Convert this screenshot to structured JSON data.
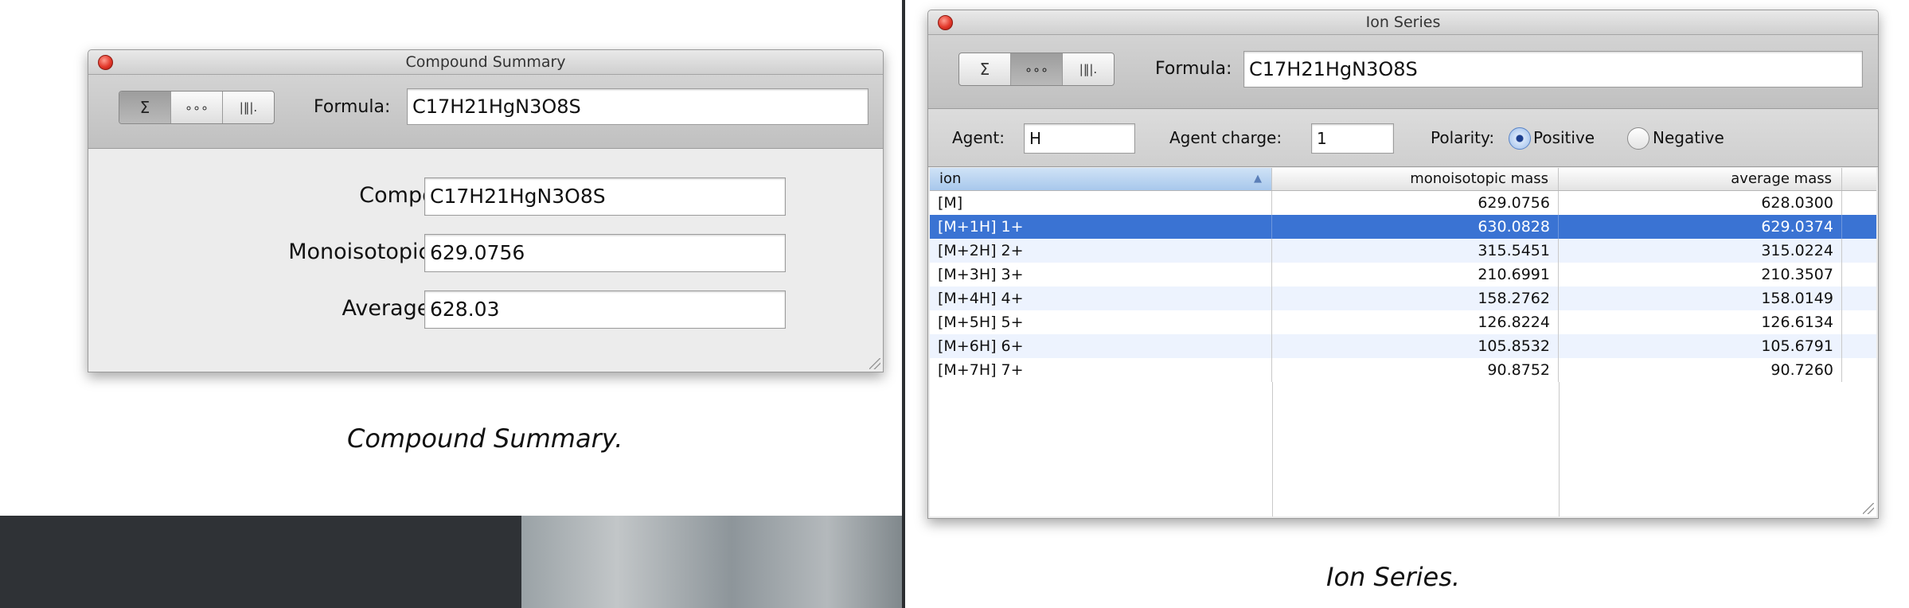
{
  "compound_summary": {
    "window_title": "Compound Summary",
    "toolbar": {
      "btn_sum": "Σ",
      "btn_molecule": "∘∘∘",
      "btn_spectrum": "|‖|."
    },
    "formula_label": "Formula:",
    "formula_value": "C17H21HgN3O8S",
    "composition_label": "Composition:",
    "composition_value": "C17H21HgN3O8S",
    "mono_label": "Monoisotopic mass:",
    "mono_value": "629.0756",
    "avg_label": "Average mass:",
    "avg_value": "628.03",
    "caption": "Compound Summary."
  },
  "ion_series": {
    "window_title": "Ion Series",
    "toolbar": {
      "btn_sum": "Σ",
      "btn_molecule": "∘∘∘",
      "btn_spectrum": "|‖|."
    },
    "formula_label": "Formula:",
    "formula_value": "C17H21HgN3O8S",
    "agent_label": "Agent:",
    "agent_value": "H",
    "charge_label": "Agent charge:",
    "charge_value": "1",
    "polarity_label": "Polarity:",
    "positive_label": "Positive",
    "negative_label": "Negative",
    "polarity_selected": "Positive",
    "columns": [
      "ion",
      "monoisotopic mass",
      "average mass"
    ],
    "rows": [
      {
        "ion": "[M]",
        "mono": "629.0756",
        "avg": "628.0300"
      },
      {
        "ion": "[M+1H] 1+",
        "mono": "630.0828",
        "avg": "629.0374"
      },
      {
        "ion": "[M+2H] 2+",
        "mono": "315.5451",
        "avg": "315.0224"
      },
      {
        "ion": "[M+3H] 3+",
        "mono": "210.6991",
        "avg": "210.3507"
      },
      {
        "ion": "[M+4H] 4+",
        "mono": "158.2762",
        "avg": "158.0149"
      },
      {
        "ion": "[M+5H] 5+",
        "mono": "126.8224",
        "avg": "126.6134"
      },
      {
        "ion": "[M+6H] 6+",
        "mono": "105.8532",
        "avg": "105.6791"
      },
      {
        "ion": "[M+7H] 7+",
        "mono": "90.8752",
        "avg": "90.7260"
      }
    ],
    "selected_row": 1,
    "caption": "Ion Series."
  },
  "colors": {
    "selection": "#3a73d3",
    "close_button": "#e3382b"
  }
}
